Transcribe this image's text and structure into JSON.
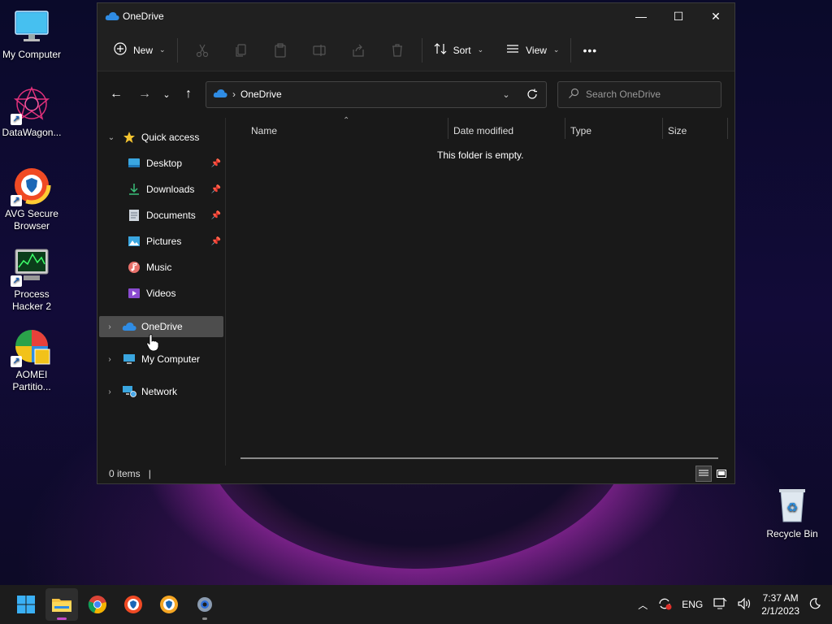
{
  "desktop": {
    "icons": [
      {
        "label": "My Computer",
        "name": "my-computer"
      },
      {
        "label": "DataWagon...",
        "name": "datawagon"
      },
      {
        "label": "AVG Secure Browser",
        "name": "avg-secure-browser"
      },
      {
        "label": "Process Hacker 2",
        "name": "process-hacker"
      },
      {
        "label": "AOMEI Partitio...",
        "name": "aomei-partition"
      },
      {
        "label": "Recycle Bin",
        "name": "recycle-bin"
      }
    ]
  },
  "window": {
    "title": "OneDrive",
    "controls": {
      "minimize": "—",
      "maximize": "☐",
      "close": "✕"
    }
  },
  "toolbar": {
    "new_label": "New",
    "sort_label": "Sort",
    "view_label": "View",
    "more_label": "•••"
  },
  "address": {
    "crumb": "OneDrive",
    "search_placeholder": "Search OneDrive"
  },
  "nav": {
    "quick_access": "Quick access",
    "items": [
      {
        "label": "Desktop"
      },
      {
        "label": "Downloads"
      },
      {
        "label": "Documents"
      },
      {
        "label": "Pictures"
      },
      {
        "label": "Music"
      },
      {
        "label": "Videos"
      }
    ],
    "onedrive": "OneDrive",
    "my_computer": "My Computer",
    "network": "Network"
  },
  "columns": {
    "name": "Name",
    "date_modified": "Date modified",
    "type": "Type",
    "size": "Size"
  },
  "content": {
    "empty_message": "This folder is empty."
  },
  "status": {
    "items": "0 items"
  },
  "tray": {
    "language": "ENG",
    "time": "7:37 AM",
    "date": "2/1/2023"
  },
  "colors": {
    "accent": "#0078d4",
    "selected": "#4d4d4d",
    "window_bg": "#191919"
  }
}
